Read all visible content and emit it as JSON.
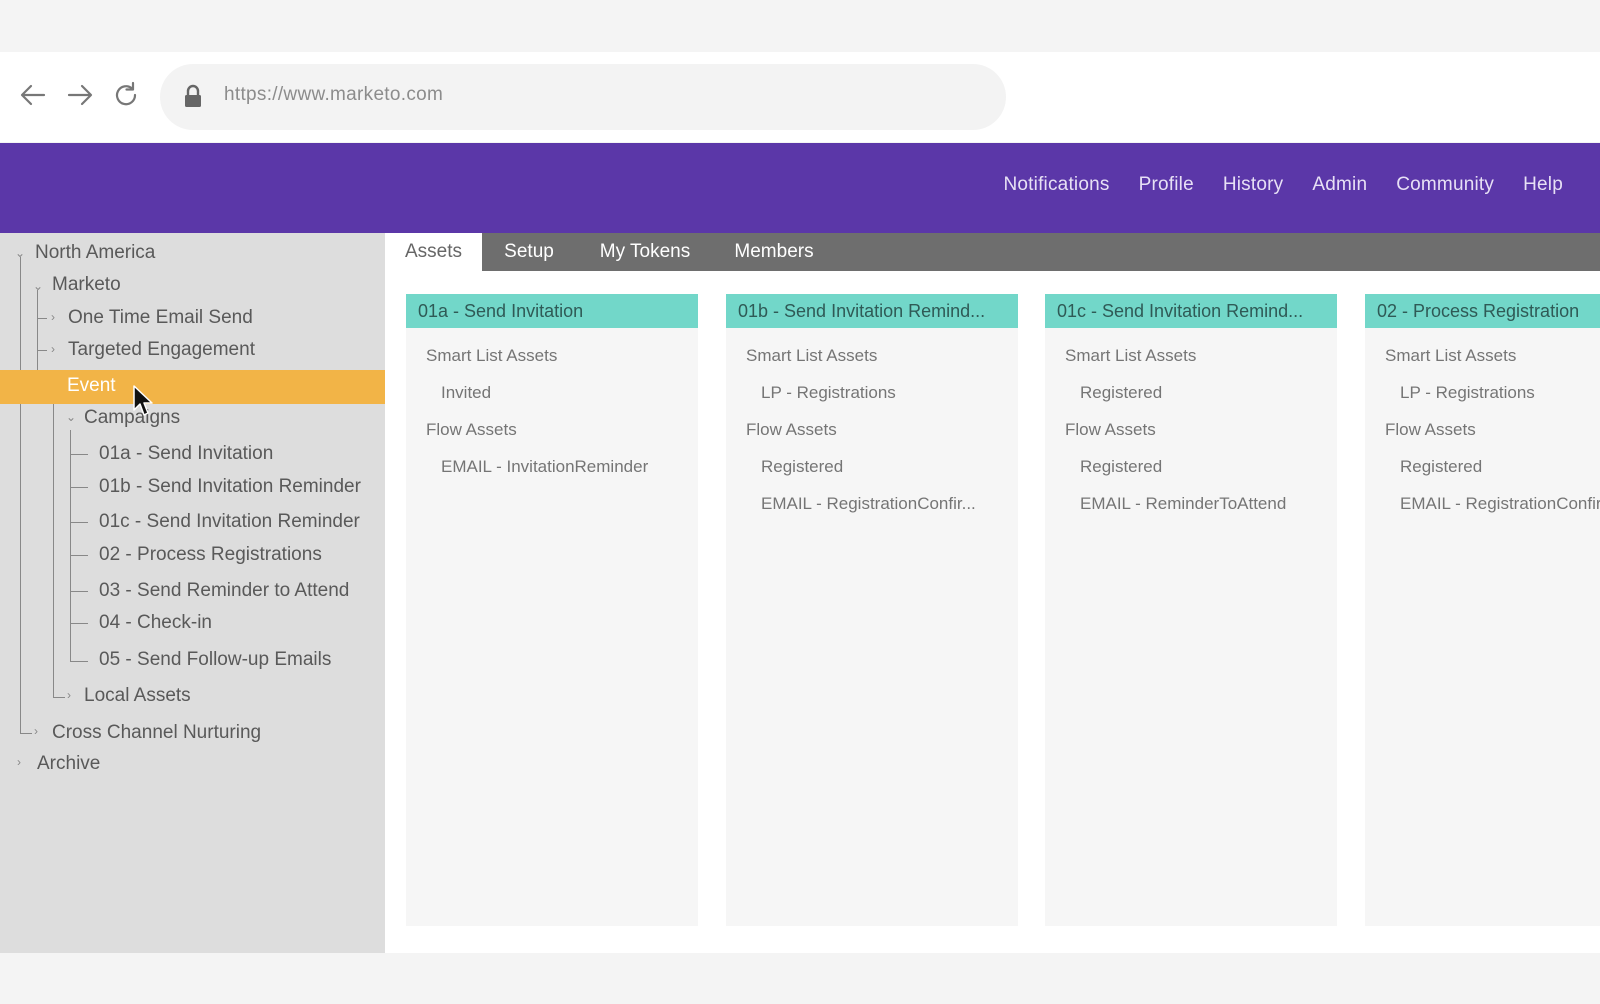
{
  "browser": {
    "url": "https://www.marketo.com",
    "icons": [
      "back-arrow-icon",
      "forward-arrow-icon",
      "reload-icon",
      "lock-icon"
    ]
  },
  "header": {
    "nav": [
      "Notifications",
      "Profile",
      "History",
      "Admin",
      "Community",
      "Help"
    ],
    "color": "#5b37a8"
  },
  "sidebar": {
    "items": [
      "North America",
      "Marketo",
      "One Time Email Send",
      "Targeted Engagement",
      "Event",
      "Campaigns",
      "01a - Send Invitation",
      "01b - Send Invitation Reminder",
      "01c - Send Invitation Reminder",
      "02 - Process Registrations",
      "03 - Send Reminder to Attend",
      "04 - Check-in",
      "05 - Send Follow-up Emails",
      "Local Assets",
      "Cross Channel Nurturing",
      "Archive"
    ],
    "selected": "Event",
    "selected_color": "#f2b447"
  },
  "tabs": [
    "Assets",
    "Setup",
    "My Tokens",
    "Members"
  ],
  "active_tab": "Assets",
  "cards": [
    {
      "title": "01a - Send Invitation",
      "smart_list_label": "Smart List Assets",
      "smart_list_items": [
        "Invited"
      ],
      "flow_label": "Flow Assets",
      "flow_items": [
        "EMAIL - InvitationReminder"
      ]
    },
    {
      "title": "01b - Send Invitation Remind...",
      "smart_list_label": "Smart List Assets",
      "smart_list_items": [
        "LP - Registrations"
      ],
      "flow_label": "Flow Assets",
      "flow_items": [
        "Registered",
        "EMAIL - RegistrationConfir..."
      ]
    },
    {
      "title": "01c - Send Invitation Remind...",
      "smart_list_label": "Smart List Assets",
      "smart_list_items": [
        "Registered"
      ],
      "flow_label": "Flow Assets",
      "flow_items": [
        "Registered",
        "EMAIL - ReminderToAttend"
      ]
    },
    {
      "title": "02 - Process Registration",
      "smart_list_label": "Smart List Assets",
      "smart_list_items": [
        "LP - Registrations"
      ],
      "flow_label": "Flow Assets",
      "flow_items": [
        "Registered",
        "EMAIL - RegistrationConfir..."
      ]
    }
  ],
  "card_header_color": "#72d7c9"
}
